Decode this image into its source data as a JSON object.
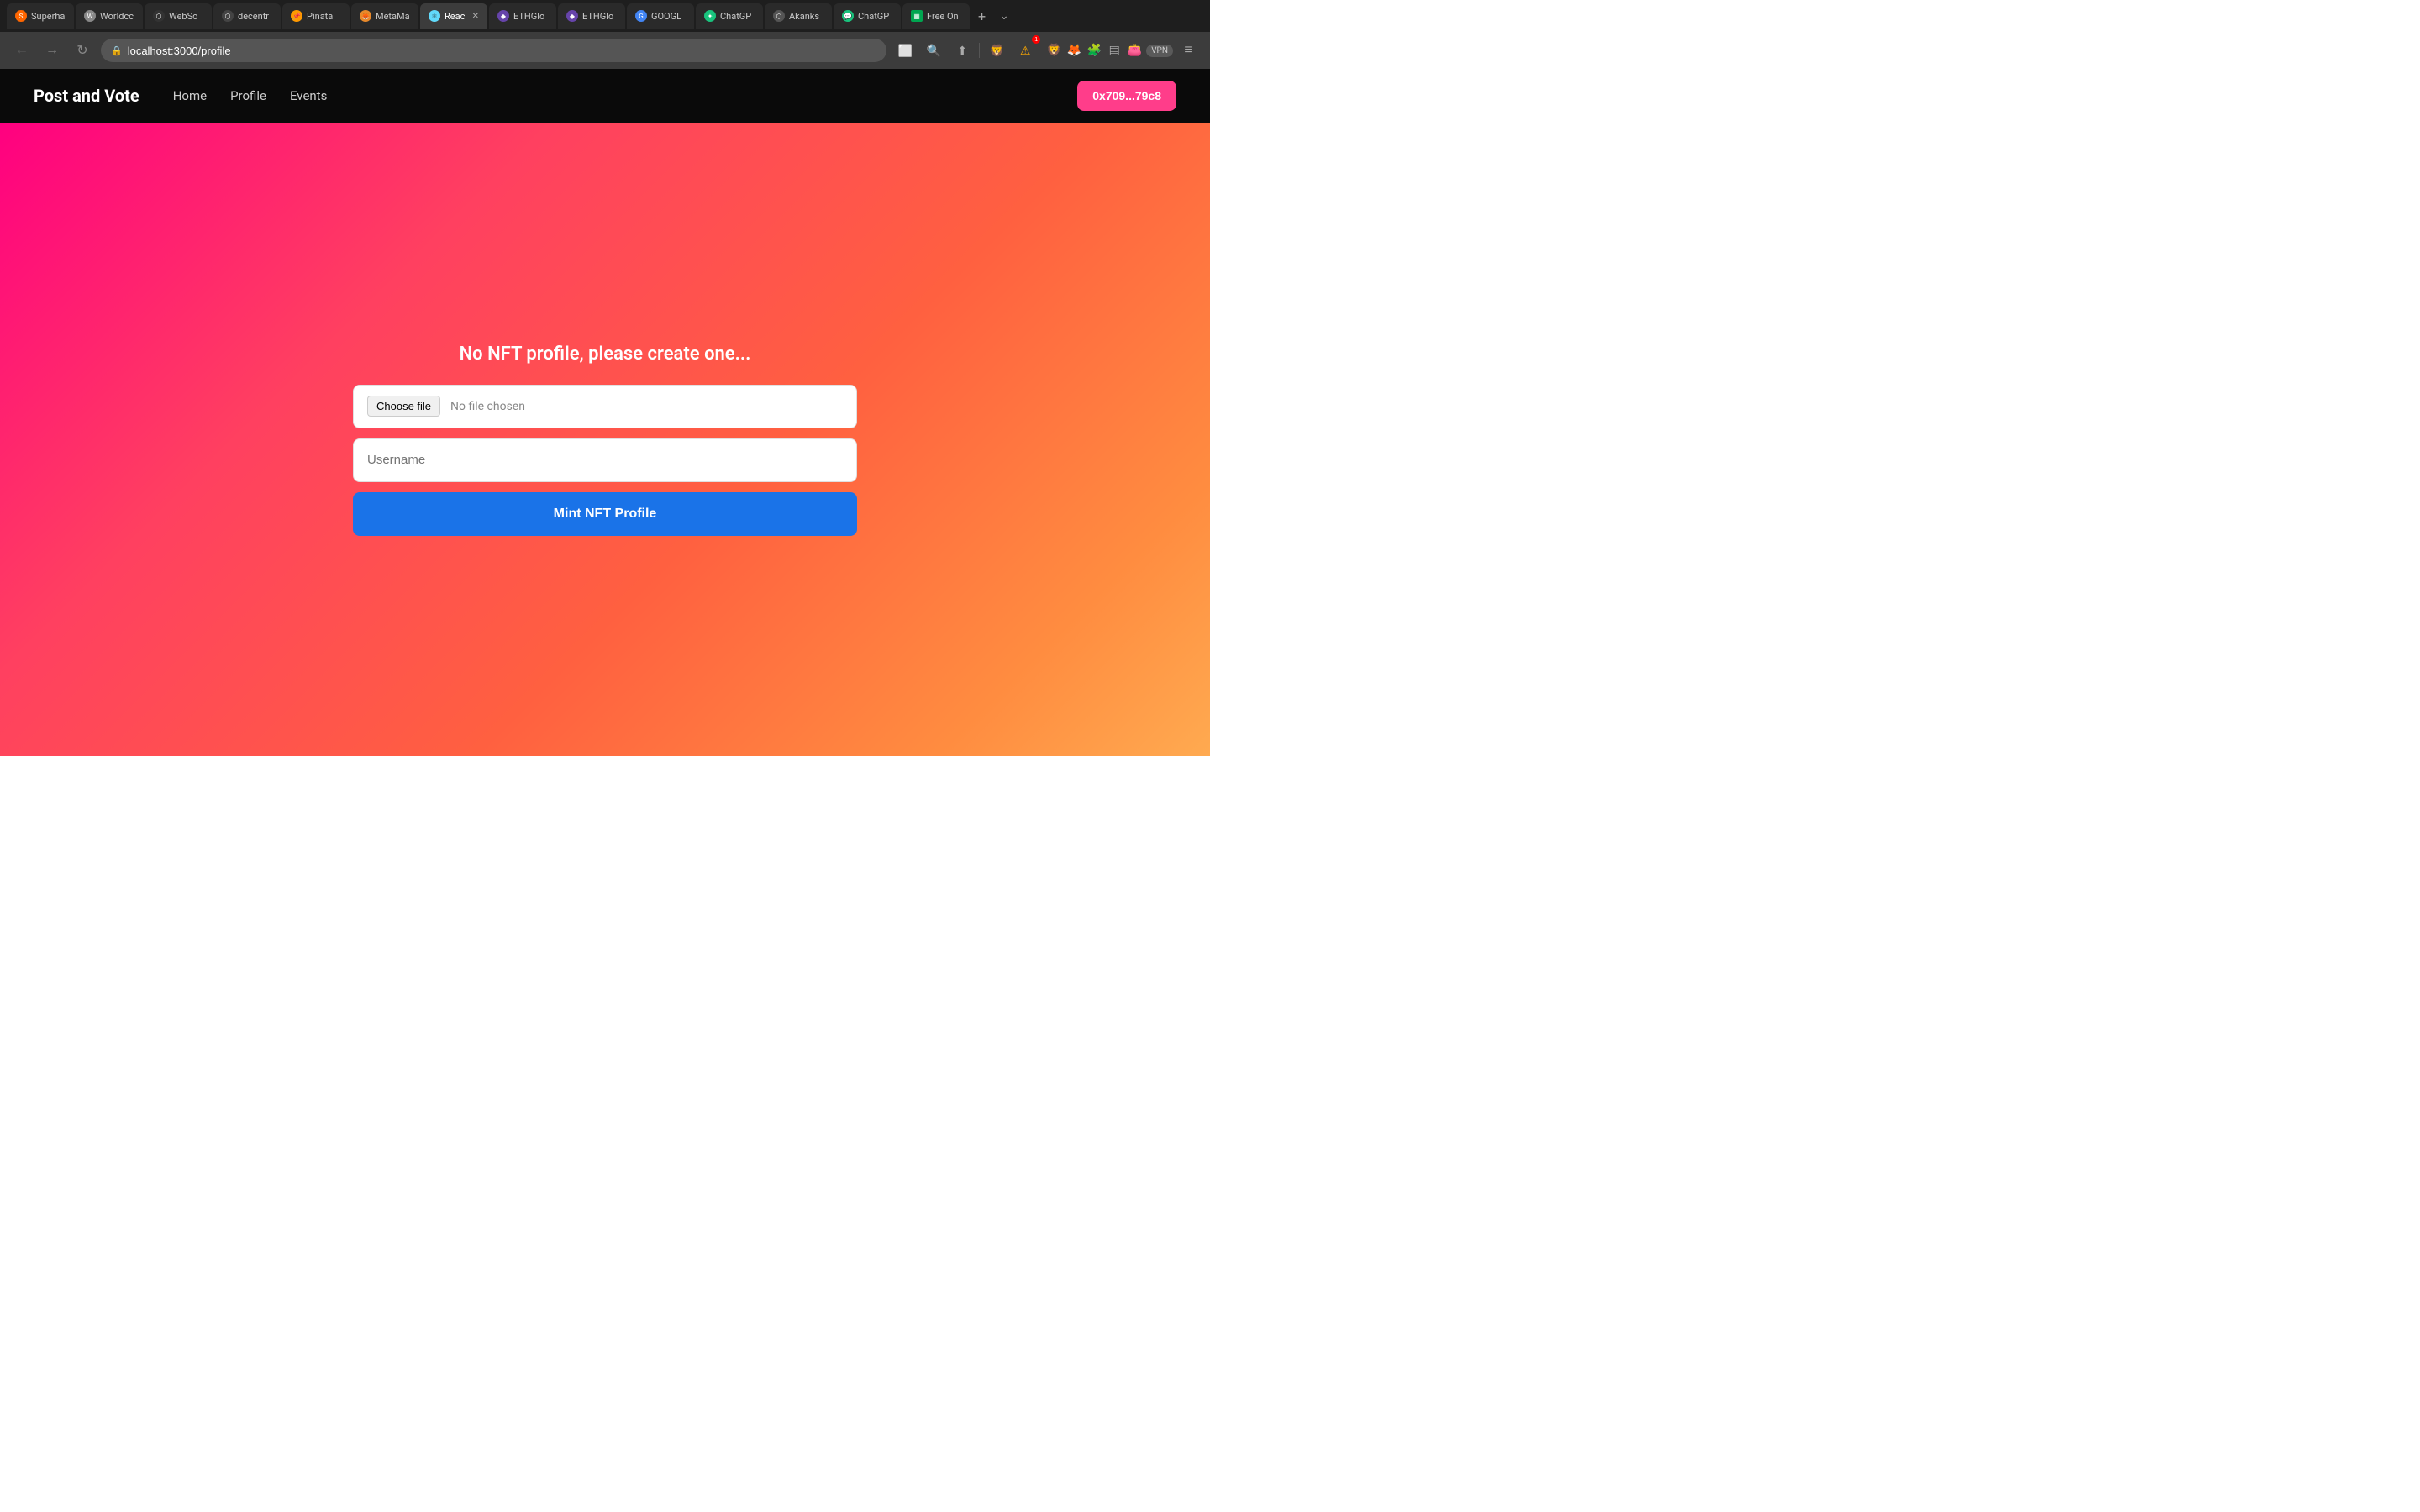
{
  "browser": {
    "tabs": [
      {
        "id": "superha",
        "label": "Superha",
        "active": false,
        "icon": "🔶"
      },
      {
        "id": "worldcc",
        "label": "Worldcc",
        "active": false,
        "icon": "🌐"
      },
      {
        "id": "webso",
        "label": "WebSo",
        "active": false,
        "icon": "⬡"
      },
      {
        "id": "decentr",
        "label": "decentr",
        "active": false,
        "icon": "⬡"
      },
      {
        "id": "pinata",
        "label": "Pinata",
        "active": false,
        "icon": "📌"
      },
      {
        "id": "metama",
        "label": "MetaMa",
        "active": false,
        "icon": "🦊"
      },
      {
        "id": "react",
        "label": "Reac",
        "active": true,
        "icon": "⚛"
      },
      {
        "id": "ethglo1",
        "label": "ETHGlo",
        "active": false,
        "icon": "◆"
      },
      {
        "id": "ethglo2",
        "label": "ETHGlo",
        "active": false,
        "icon": "◆"
      },
      {
        "id": "google",
        "label": "GOOGL",
        "active": false,
        "icon": "G"
      },
      {
        "id": "chatgp1",
        "label": "ChatGP",
        "active": false,
        "icon": "✦"
      },
      {
        "id": "akanks",
        "label": "Akanks",
        "active": false,
        "icon": "⬡"
      },
      {
        "id": "chatgp2",
        "label": "ChatGP",
        "active": false,
        "icon": "💬"
      },
      {
        "id": "freeon",
        "label": "Free On",
        "active": false,
        "icon": "▦"
      }
    ],
    "address": "localhost:3000/profile",
    "address_placeholder": "localhost:3000/profile"
  },
  "navbar": {
    "brand": "Post and Vote",
    "links": [
      {
        "label": "Home",
        "href": "/"
      },
      {
        "label": "Profile",
        "href": "/profile"
      },
      {
        "label": "Events",
        "href": "/events"
      }
    ],
    "wallet_button": "0x709...79c8"
  },
  "main": {
    "no_profile_text": "No NFT profile, please create one...",
    "choose_file_label": "Choose file",
    "no_file_text": "No file chosen",
    "username_placeholder": "Username",
    "mint_button": "Mint NFT Profile"
  }
}
